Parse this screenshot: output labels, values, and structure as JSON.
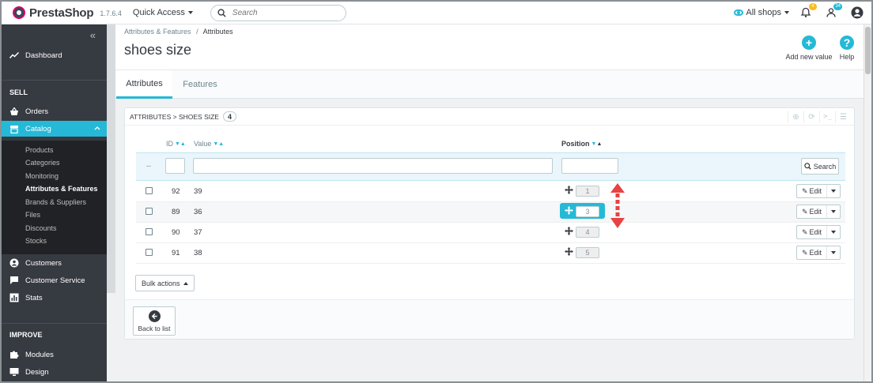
{
  "topbar": {
    "brand": "PrestaShop",
    "version": "1.7.6.4",
    "quick_access": "Quick Access",
    "search_placeholder": "Search",
    "shop_selector": "All shops",
    "notification_badges": [
      "4",
      "34"
    ]
  },
  "sidebar": {
    "dashboard": "Dashboard",
    "sell_title": "SELL",
    "orders": "Orders",
    "catalog": "Catalog",
    "catalog_items": [
      "Products",
      "Categories",
      "Monitoring",
      "Attributes & Features",
      "Brands & Suppliers",
      "Files",
      "Discounts",
      "Stocks"
    ],
    "customers": "Customers",
    "customer_service": "Customer Service",
    "stats": "Stats",
    "improve_title": "IMPROVE",
    "modules": "Modules",
    "design": "Design"
  },
  "header": {
    "breadcrumb_parent": "Attributes & Features",
    "breadcrumb_sep": "/",
    "breadcrumb_current": "Attributes",
    "title": "shoes size",
    "add_new": "Add new value",
    "help": "Help"
  },
  "tabs": [
    "Attributes",
    "Features"
  ],
  "panel": {
    "heading": "ATTRIBUTES > SHOES SIZE",
    "count": "4",
    "columns": {
      "id": "ID",
      "value": "Value",
      "position": "Position"
    },
    "filter_dash": "--",
    "search_button": "Search",
    "edit_label": "Edit",
    "rows": [
      {
        "id": "92",
        "value": "39",
        "position": "1"
      },
      {
        "id": "89",
        "value": "36",
        "position": "3"
      },
      {
        "id": "90",
        "value": "37",
        "position": "4"
      },
      {
        "id": "91",
        "value": "38",
        "position": "5"
      }
    ],
    "bulk_actions": "Bulk actions",
    "back_to_list": "Back to list"
  },
  "colors": {
    "accent": "#25b9d7",
    "sidebar": "#363a41",
    "arrow": "#e84242"
  }
}
